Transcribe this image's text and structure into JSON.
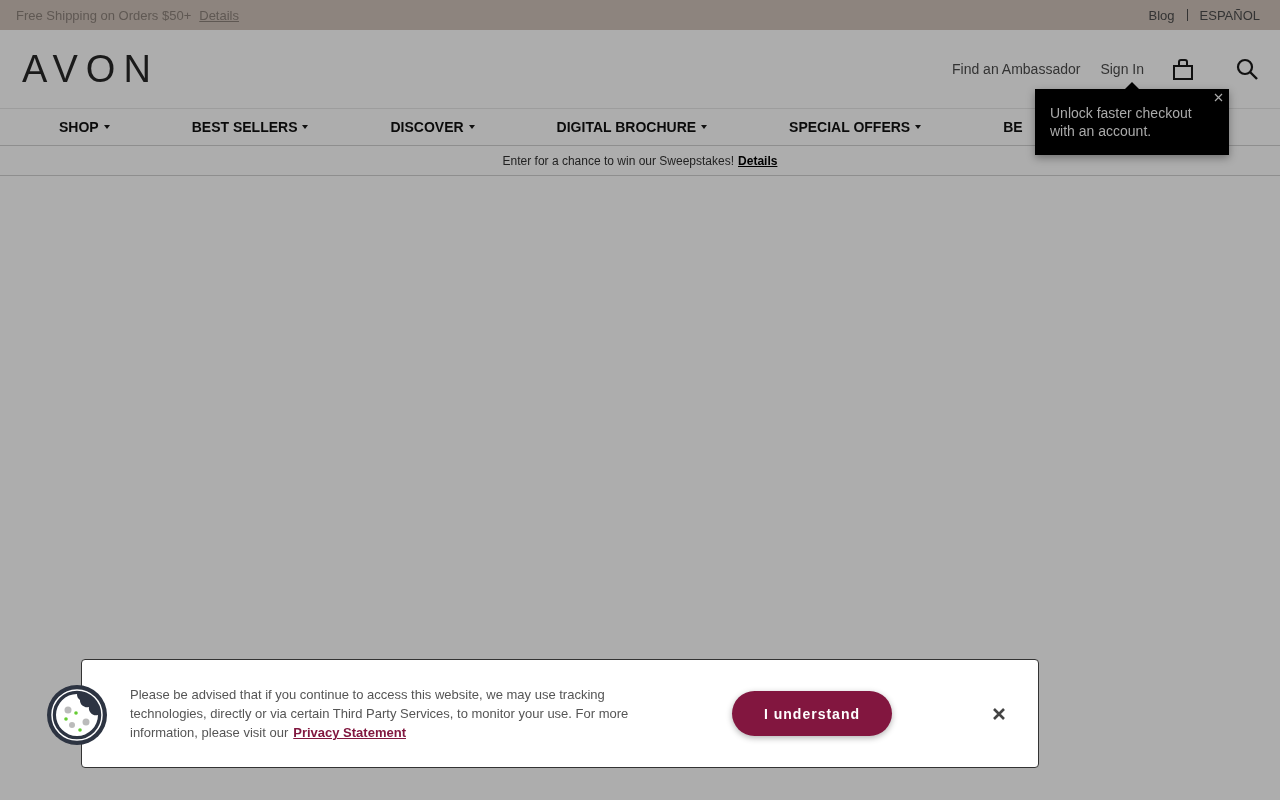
{
  "utility_bar": {
    "promo": "Free Shipping on Orders $50+",
    "promo_link": "Details",
    "links": [
      "Blog",
      "ESPAÑOL"
    ]
  },
  "header": {
    "logo": "AVON",
    "links": [
      "Find an Ambassador",
      "Sign In"
    ]
  },
  "nav": [
    {
      "label": "SHOP",
      "has_menu": true
    },
    {
      "label": "BEST SELLERS",
      "has_menu": true
    },
    {
      "label": "DISCOVER",
      "has_menu": true
    },
    {
      "label": "DIGITAL BROCHURE",
      "has_menu": true
    },
    {
      "label": "SPECIAL OFFERS",
      "has_menu": true
    },
    {
      "label": "BE",
      "has_menu": false
    }
  ],
  "announcement": {
    "text": "Enter for a chance to win our Sweepstakes!",
    "link": "Details"
  },
  "tooltip": {
    "text": "Unlock faster checkout with an account."
  },
  "cookie_banner": {
    "text": "Please be advised that if you continue to access this website, we may use tracking technologies, directly or via certain Third Party Services, to monitor your use. For more information, please visit our",
    "link": "Privacy Statement",
    "button": "I understand"
  }
}
